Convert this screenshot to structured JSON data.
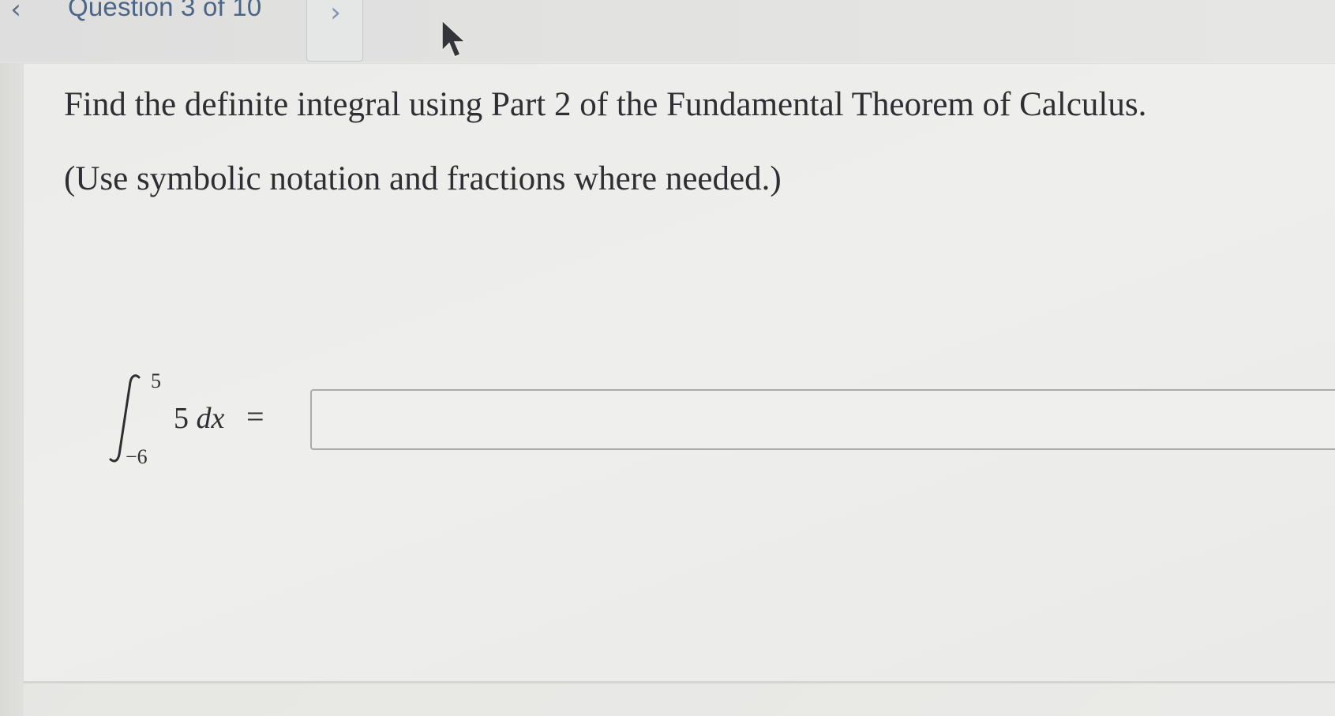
{
  "header": {
    "prev_icon": "chevron-left-icon",
    "prev_glyph": "‹",
    "question_counter": "Question 3 of 10",
    "next_icon": "chevron-right-icon",
    "next_glyph": "›"
  },
  "question": {
    "prompt": "Find the definite integral using Part 2 of the Fundamental Theorem of Calculus.",
    "hint": "(Use symbolic notation and fractions where needed.)",
    "expression": {
      "upper_limit": "5",
      "lower_limit": "−6",
      "integrand_coefficient": "5",
      "differential": "dx",
      "equals": "="
    },
    "answer": {
      "value": "",
      "placeholder": ""
    }
  },
  "colors": {
    "text": "#2f2f33",
    "header_text": "#4a6585",
    "input_border": "#a9aaab"
  }
}
